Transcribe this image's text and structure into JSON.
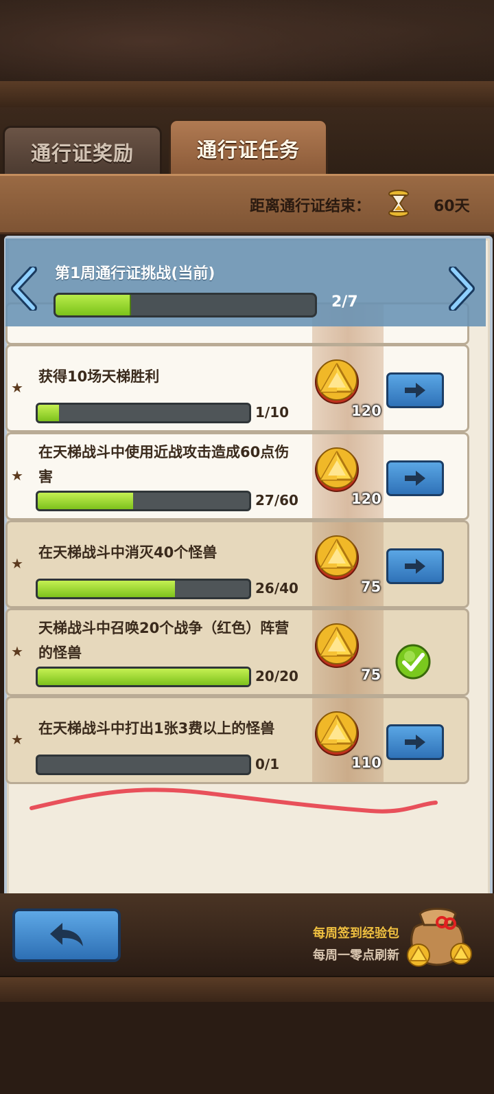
{
  "tabs": {
    "rewards_label": "通行证奖励",
    "tasks_label": "通行证任务"
  },
  "timer": {
    "label": "距离通行证结束：",
    "value": "60天"
  },
  "week": {
    "title": "第1周通行证挑战(当前)",
    "progress_text": "2/7",
    "progress_fraction": 0.2857
  },
  "tasks": [
    {
      "text": "获得10场天梯胜利",
      "progress": "1/10",
      "fraction": 0.1,
      "reward": "120",
      "status": "go"
    },
    {
      "text": "在天梯战斗中使用近战攻击造成60点伤害",
      "progress": "27/60",
      "fraction": 0.45,
      "reward": "120",
      "status": "go"
    },
    {
      "text": "在天梯战斗中消灭40个怪兽",
      "progress": "26/40",
      "fraction": 0.65,
      "reward": "75",
      "status": "go"
    },
    {
      "text": "天梯战斗中召唤20个战争（红色）阵营的怪兽",
      "progress": "20/20",
      "fraction": 1.0,
      "reward": "75",
      "status": "done"
    },
    {
      "text": "在天梯战斗中打出1张3费以上的怪兽",
      "progress": "0/1",
      "fraction": 0.0,
      "reward": "110",
      "status": "go"
    }
  ],
  "pack": {
    "title": "每周签到经验包",
    "subtitle": "每周一零点刷新"
  },
  "colors": {
    "progress_green": "#7bc21a",
    "button_blue": "#2f72b8",
    "wood": "#8a5a38"
  },
  "icons": {
    "timer": "hourglass-icon",
    "reward": "gold-coin-icon",
    "go": "arrow-right-icon",
    "done": "checkmark-icon",
    "back": "back-arrow-icon",
    "pack": "loot-bag-icon"
  }
}
